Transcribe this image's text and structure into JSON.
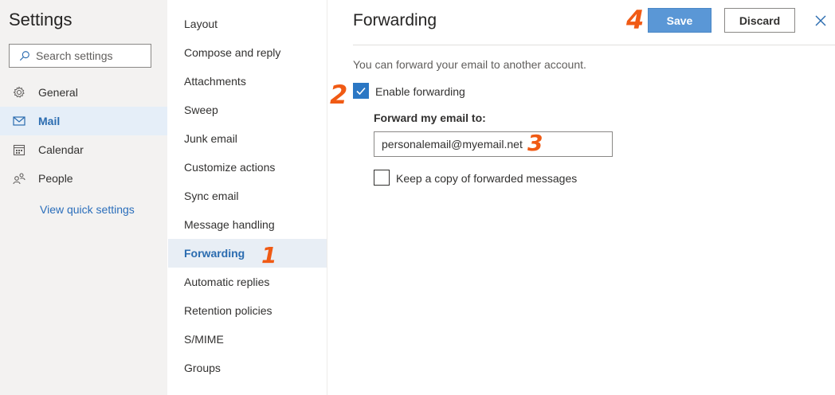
{
  "left": {
    "title": "Settings",
    "search_placeholder": "Search settings",
    "nav": [
      {
        "label": "General",
        "icon": "gear-icon"
      },
      {
        "label": "Mail",
        "icon": "mail-icon",
        "selected": true
      },
      {
        "label": "Calendar",
        "icon": "calendar-icon"
      },
      {
        "label": "People",
        "icon": "people-icon"
      }
    ],
    "quick_link": "View quick settings"
  },
  "middle": {
    "items": [
      "Layout",
      "Compose and reply",
      "Attachments",
      "Sweep",
      "Junk email",
      "Customize actions",
      "Sync email",
      "Message handling",
      "Forwarding",
      "Automatic replies",
      "Retention policies",
      "S/MIME",
      "Groups"
    ],
    "selected": "Forwarding"
  },
  "main": {
    "title": "Forwarding",
    "save_label": "Save",
    "discard_label": "Discard",
    "description": "You can forward your email to another account.",
    "enable_forwarding_label": "Enable forwarding",
    "enable_forwarding_checked": true,
    "forward_to_label": "Forward my email to:",
    "forward_to_value": "personalemail@myemail.net",
    "keep_copy_label": "Keep a copy of forwarded messages",
    "keep_copy_checked": false
  },
  "annotations": {
    "step1": "1",
    "step2": "2",
    "step3": "3",
    "step4": "4"
  },
  "colors": {
    "accent": "#2b6cb0",
    "save_button": "#5a97d6",
    "annotation": "#f05a14",
    "left_pane_bg": "#f3f2f1"
  }
}
